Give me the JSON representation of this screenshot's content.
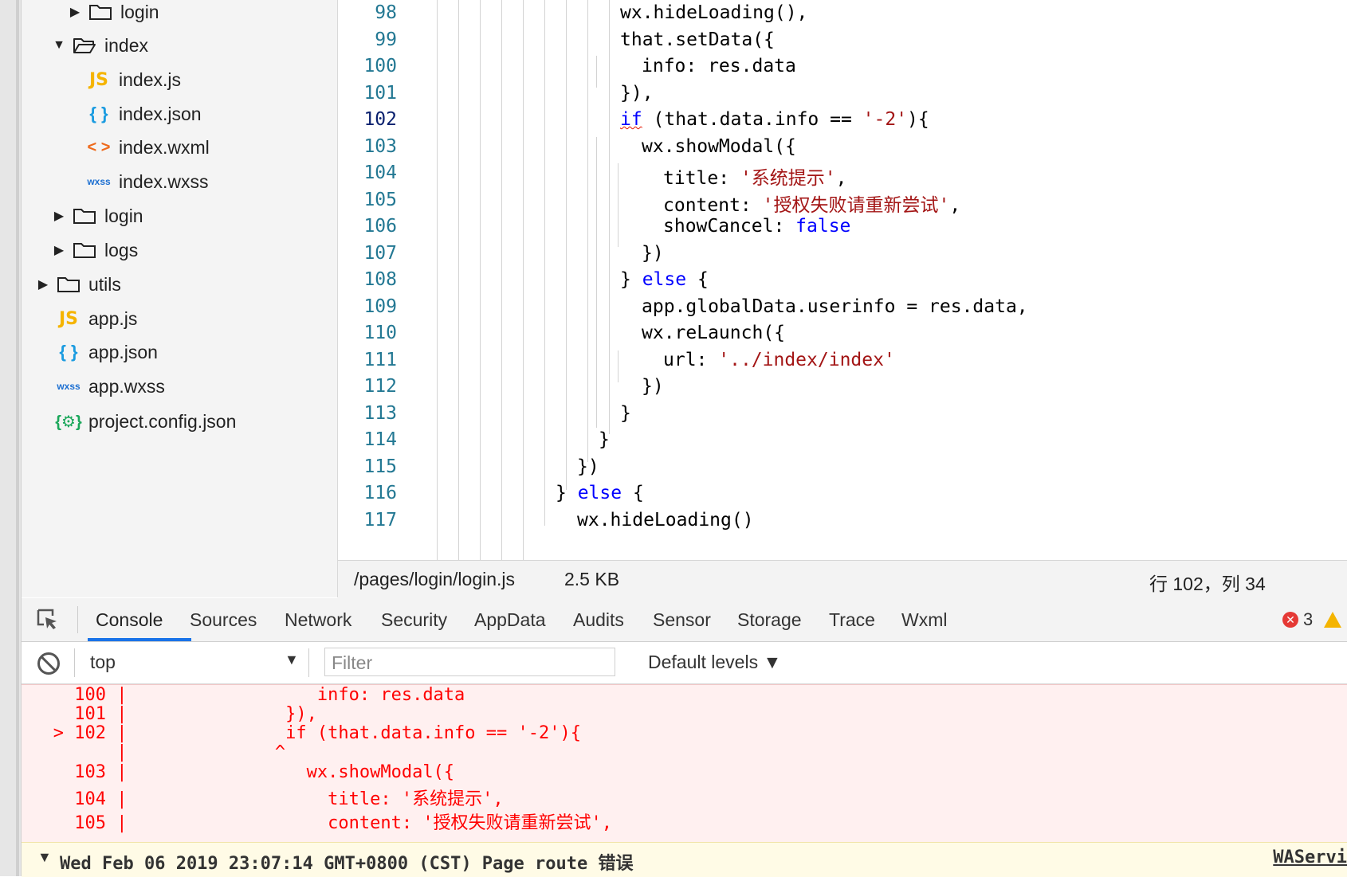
{
  "file_tree": {
    "items": [
      {
        "label": "login",
        "type": "folder",
        "expanded": false
      },
      {
        "label": "index",
        "type": "folder",
        "expanded": true
      },
      {
        "label": "index.js",
        "type": "js",
        "icon": "JS"
      },
      {
        "label": "index.json",
        "type": "json",
        "icon": "{ }"
      },
      {
        "label": "index.wxml",
        "type": "wxml",
        "icon": "< >"
      },
      {
        "label": "index.wxss",
        "type": "wxss",
        "icon": "wxss"
      },
      {
        "label": "login",
        "type": "folder",
        "expanded": false
      },
      {
        "label": "logs",
        "type": "folder",
        "expanded": false
      },
      {
        "label": "utils",
        "type": "folder",
        "expanded": false
      },
      {
        "label": "app.js",
        "type": "js",
        "icon": "JS"
      },
      {
        "label": "app.json",
        "type": "json",
        "icon": "{ }"
      },
      {
        "label": "app.wxss",
        "type": "wxss",
        "icon": "wxss"
      },
      {
        "label": "project.config.json",
        "type": "config",
        "icon": "{⚙}"
      }
    ]
  },
  "editor": {
    "current_line": "102",
    "line_numbers": [
      "98",
      "99",
      "100",
      "101",
      "102",
      "103",
      "104",
      "105",
      "106",
      "107",
      "108",
      "109",
      "110",
      "111",
      "112",
      "113",
      "114",
      "115",
      "116",
      "117"
    ],
    "lines": {
      "l98": {
        "t": "wx.hideLoading(),"
      },
      "l99": {
        "t": "that.setData({"
      },
      "l100": {
        "t": "info: res.data"
      },
      "l101": {
        "t": "}),"
      },
      "l102": {
        "kw": "if",
        "a": " (that.data.info == ",
        "s": "'-2'",
        "b": "){"
      },
      "l103": {
        "t": "wx.showModal({"
      },
      "l104": {
        "a": "title: ",
        "s": "'系统提示'",
        "b": ","
      },
      "l105": {
        "a": "content: ",
        "s": "'授权失败请重新尝试'",
        "b": ","
      },
      "l106": {
        "a": "showCancel: ",
        "kw": "false"
      },
      "l107": {
        "t": "})"
      },
      "l108": {
        "a": "} ",
        "kw": "else",
        "b": " {"
      },
      "l109": {
        "t": "app.globalData.userinfo = res.data,"
      },
      "l110": {
        "t": "wx.reLaunch({"
      },
      "l111": {
        "a": "url: ",
        "s": "'../index/index'"
      },
      "l112": {
        "t": "})"
      },
      "l113": {
        "t": "}"
      },
      "l114": {
        "t": "}"
      },
      "l115": {
        "t": "})"
      },
      "l116": {
        "a": "} ",
        "kw": "else",
        "b": " {"
      },
      "l117": {
        "t": "wx.hideLoading()"
      }
    }
  },
  "status_bar": {
    "path": "/pages/login/login.js",
    "size": "2.5 KB",
    "position": "行 102，列 34"
  },
  "devtools": {
    "tabs": [
      "Console",
      "Sources",
      "Network",
      "Security",
      "AppData",
      "Audits",
      "Sensor",
      "Storage",
      "Trace",
      "Wxml"
    ],
    "active_tab": "Console",
    "error_count": "3",
    "error_icon": "x-circle-icon",
    "warning_icon": "warning-icon",
    "context": "top",
    "filter_placeholder": "Filter",
    "levels": "Default levels"
  },
  "console": {
    "lines": [
      "     100 |                  info: res.data",
      "     101 |               }),",
      "   > 102 |               if (that.data.info == '-2'){",
      "         |              ^",
      "     103 |                 wx.showModal({",
      "     104 |                   title: '系统提示',",
      "     105 |                   content: '授权失败请重新尝试',"
    ],
    "message": "Wed Feb 06 2019 23:07:14 GMT+0800 (CST) Page route 错误",
    "source": "WAServi"
  },
  "colors": {
    "keyword": "#0000ff",
    "string": "#a31515",
    "line_number": "#237893",
    "error_text": "#ff0000",
    "error_bg": "#fff0f0",
    "active_tab": "#1a73e8"
  }
}
